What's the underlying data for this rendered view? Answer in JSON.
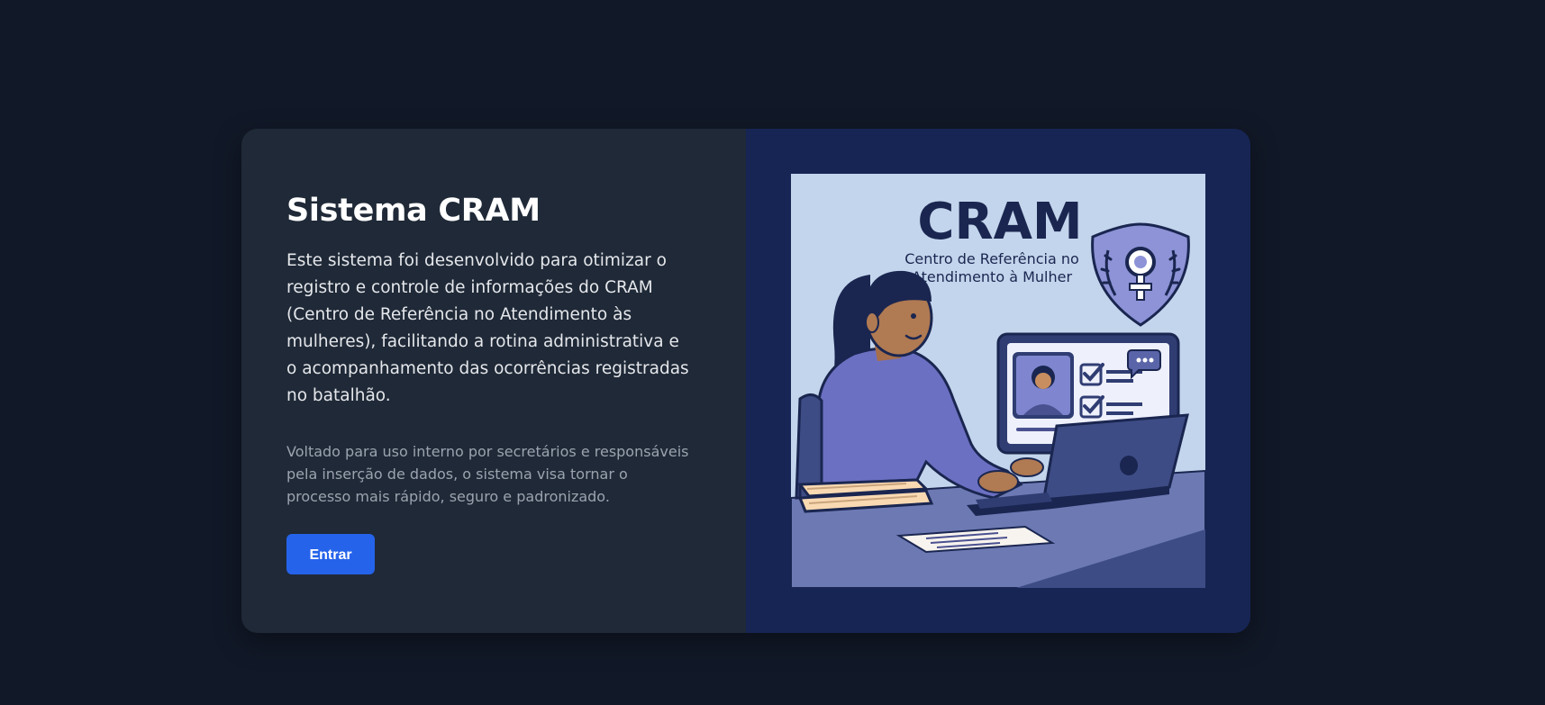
{
  "card": {
    "title": "Sistema CRAM",
    "description": "Este sistema foi desenvolvido para otimizar o registro e controle de informações do CRAM (Centro de Referência no Atendimento às mulheres), facilitando a rotina administrativa e o acompanhamento das ocorrências registradas no batalhão.",
    "note": "Voltado para uso interno por secretários e responsáveis pela inserção de dados, o sistema visa tornar o processo mais rápido, seguro e padronizado.",
    "enter_label": "Entrar"
  },
  "illustration": {
    "brand": "CRAM",
    "subtitle_line1": "Centro de Referência no",
    "subtitle_line2": "Atendimento à Mulher",
    "icons": [
      "shield-icon",
      "female-symbol-icon",
      "checkbox-icon",
      "chat-bubble-icon",
      "laptop-icon",
      "books-icon",
      "document-icon"
    ]
  },
  "colors": {
    "page_background": "#111827",
    "left_panel": "#1f2937",
    "right_panel": "#172554",
    "button": "#2563eb",
    "illustration_background": "#c3d5ec",
    "brand_navy": "#1a2650",
    "purple": "#6c70c2"
  }
}
